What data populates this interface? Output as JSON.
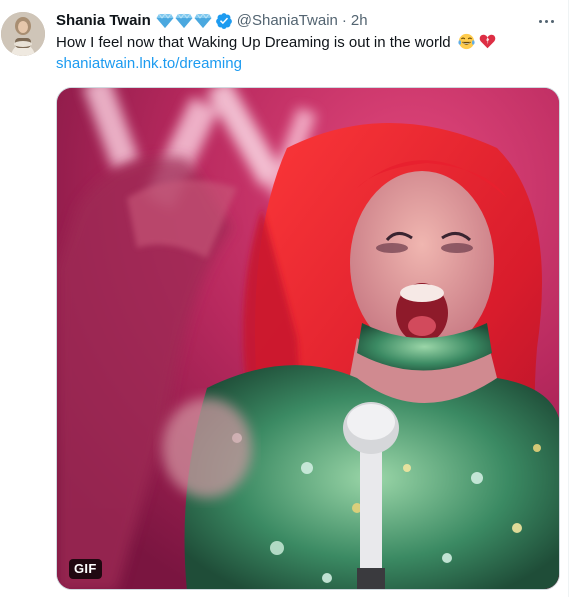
{
  "tweet": {
    "display_name": "Shania Twain",
    "name_emojis": [
      "diamond-emoji",
      "diamond-emoji",
      "diamond-emoji"
    ],
    "verified": true,
    "handle": "@ShaniaTwain",
    "separator": "·",
    "time": "2h",
    "text": "How I feel now that Waking Up Dreaming is out in the world",
    "text_emojis": [
      "tears-of-joy-emoji",
      "heart-emoji"
    ],
    "link": "shaniatwain.lnk.to/dreaming",
    "media": {
      "type": "gif",
      "badge": "GIF"
    }
  },
  "colors": {
    "link": "#1d9bf0",
    "secondary_text": "#536471",
    "verified_badge": "#1d9bf0",
    "media_dominant": "#b8295e",
    "hair": "#e0242e"
  }
}
